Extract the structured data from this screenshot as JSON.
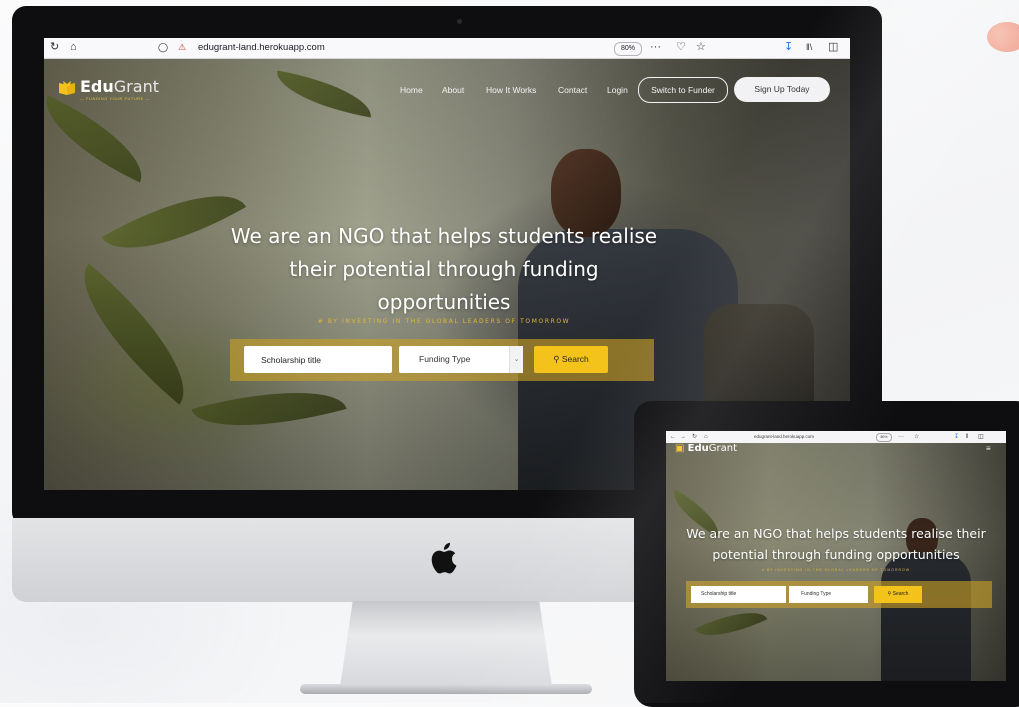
{
  "browser": {
    "url": "edugrant-land.herokuapp.com",
    "zoom": "80%",
    "icons": [
      "reload-icon",
      "home-icon",
      "shield-icon",
      "insecure-lock-icon",
      "more-icon",
      "pocket-icon",
      "bookmark-star-icon",
      "download-icon",
      "library-icon",
      "sidebar-icon"
    ]
  },
  "site": {
    "logo_bold": "Edu",
    "logo_light": "Grant",
    "logo_tagline": "— FUNDING YOUR FUTURE —",
    "nav": {
      "home": "Home",
      "about": "About",
      "how": "How It Works",
      "contact": "Contact",
      "login": "Login",
      "switch": "Switch to Funder",
      "signup": "Sign Up Today"
    },
    "headline_1": "We are an NGO that helps students realise",
    "headline_2": "their potential through funding",
    "headline_3": "opportunities",
    "tagline": "# BY INVESTING IN THE GLOBAL LEADERS OF TOMORROW",
    "search": {
      "title_value": "Scholarship title",
      "funding_selected": "Funding Type",
      "button": "Search"
    }
  },
  "tablet": {
    "url": "edugrant-land.herokuapp.com",
    "zoom": "80%",
    "headline_1": "We are an NGO that helps students realise their",
    "headline_2": "potential through funding opportunities",
    "tagline": "# BY INVESTING IN THE GLOBAL LEADERS OF TOMORROW",
    "title_value": "Scholarship title",
    "funding_selected": "Funding Type",
    "button": "Search"
  },
  "colors": {
    "accent": "#f3c21b",
    "tagline": "#e0b737",
    "download": "#2a6ef0"
  }
}
